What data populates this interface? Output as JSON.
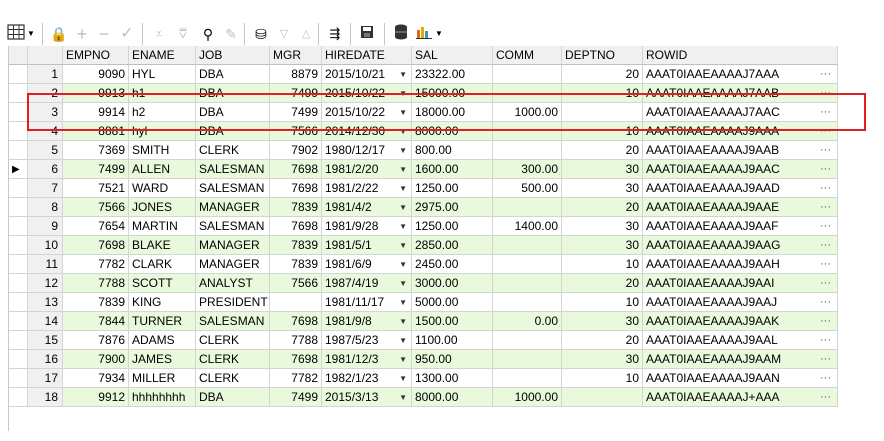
{
  "toolbar": {
    "icons": [
      "grid-icon",
      "dropdown-arrow-icon",
      "lock-icon",
      "add-icon",
      "remove-icon",
      "check-icon",
      "filter-icon",
      "filter-clear-icon",
      "binoculars-icon",
      "eraser-icon",
      "query-icon",
      "sort-down-icon",
      "sort-up-icon",
      "export-icon",
      "save-icon",
      "database-icon",
      "chart-icon"
    ]
  },
  "grid": {
    "columns": [
      "EMPNO",
      "ENAME",
      "JOB",
      "MGR",
      "HIREDATE",
      "SAL",
      "COMM",
      "DEPTNO",
      "ROWID"
    ],
    "rows": [
      {
        "n": "1",
        "empno": "9090",
        "ename": "HYL",
        "job": "DBA",
        "mgr": "8879",
        "hiredate": "2015/10/21",
        "sal": "23322.00",
        "comm": "",
        "deptno": "20",
        "rowid": "AAAT0IAAEAAAAJ7AAA"
      },
      {
        "n": "2",
        "empno": "9913",
        "ename": "h1",
        "job": "DBA",
        "mgr": "7499",
        "hiredate": "2015/10/22",
        "sal": "15000.00",
        "comm": "",
        "deptno": "10",
        "rowid": "AAAT0IAAEAAAAJ7AAB"
      },
      {
        "n": "3",
        "empno": "9914",
        "ename": "h2",
        "job": "DBA",
        "mgr": "7499",
        "hiredate": "2015/10/22",
        "sal": "18000.00",
        "comm": "1000.00",
        "deptno": "",
        "rowid": "AAAT0IAAEAAAAJ7AAC"
      },
      {
        "n": "4",
        "empno": "8881",
        "ename": "hyl",
        "job": "DBA",
        "mgr": "7566",
        "hiredate": "2014/12/30",
        "sal": "8000.00",
        "comm": "",
        "deptno": "10",
        "rowid": "AAAT0IAAEAAAAJ9AAA"
      },
      {
        "n": "5",
        "empno": "7369",
        "ename": "SMITH",
        "job": "CLERK",
        "mgr": "7902",
        "hiredate": "1980/12/17",
        "sal": "800.00",
        "comm": "",
        "deptno": "20",
        "rowid": "AAAT0IAAEAAAAJ9AAB"
      },
      {
        "n": "6",
        "empno": "7499",
        "ename": "ALLEN",
        "job": "SALESMAN",
        "mgr": "7698",
        "hiredate": "1981/2/20",
        "sal": "1600.00",
        "comm": "300.00",
        "deptno": "30",
        "rowid": "AAAT0IAAEAAAAJ9AAC"
      },
      {
        "n": "7",
        "empno": "7521",
        "ename": "WARD",
        "job": "SALESMAN",
        "mgr": "7698",
        "hiredate": "1981/2/22",
        "sal": "1250.00",
        "comm": "500.00",
        "deptno": "30",
        "rowid": "AAAT0IAAEAAAAJ9AAD"
      },
      {
        "n": "8",
        "empno": "7566",
        "ename": "JONES",
        "job": "MANAGER",
        "mgr": "7839",
        "hiredate": "1981/4/2",
        "sal": "2975.00",
        "comm": "",
        "deptno": "20",
        "rowid": "AAAT0IAAEAAAAJ9AAE"
      },
      {
        "n": "9",
        "empno": "7654",
        "ename": "MARTIN",
        "job": "SALESMAN",
        "mgr": "7698",
        "hiredate": "1981/9/28",
        "sal": "1250.00",
        "comm": "1400.00",
        "deptno": "30",
        "rowid": "AAAT0IAAEAAAAJ9AAF"
      },
      {
        "n": "10",
        "empno": "7698",
        "ename": "BLAKE",
        "job": "MANAGER",
        "mgr": "7839",
        "hiredate": "1981/5/1",
        "sal": "2850.00",
        "comm": "",
        "deptno": "30",
        "rowid": "AAAT0IAAEAAAAJ9AAG"
      },
      {
        "n": "11",
        "empno": "7782",
        "ename": "CLARK",
        "job": "MANAGER",
        "mgr": "7839",
        "hiredate": "1981/6/9",
        "sal": "2450.00",
        "comm": "",
        "deptno": "10",
        "rowid": "AAAT0IAAEAAAAJ9AAH"
      },
      {
        "n": "12",
        "empno": "7788",
        "ename": "SCOTT",
        "job": "ANALYST",
        "mgr": "7566",
        "hiredate": "1987/4/19",
        "sal": "3000.00",
        "comm": "",
        "deptno": "20",
        "rowid": "AAAT0IAAEAAAAJ9AAI"
      },
      {
        "n": "13",
        "empno": "7839",
        "ename": "KING",
        "job": "PRESIDENT",
        "mgr": "",
        "hiredate": "1981/11/17",
        "sal": "5000.00",
        "comm": "",
        "deptno": "10",
        "rowid": "AAAT0IAAEAAAAJ9AAJ"
      },
      {
        "n": "14",
        "empno": "7844",
        "ename": "TURNER",
        "job": "SALESMAN",
        "mgr": "7698",
        "hiredate": "1981/9/8",
        "sal": "1500.00",
        "comm": "0.00",
        "deptno": "30",
        "rowid": "AAAT0IAAEAAAAJ9AAK"
      },
      {
        "n": "15",
        "empno": "7876",
        "ename": "ADAMS",
        "job": "CLERK",
        "mgr": "7788",
        "hiredate": "1987/5/23",
        "sal": "1100.00",
        "comm": "",
        "deptno": "20",
        "rowid": "AAAT0IAAEAAAAJ9AAL"
      },
      {
        "n": "16",
        "empno": "7900",
        "ename": "JAMES",
        "job": "CLERK",
        "mgr": "7698",
        "hiredate": "1981/12/3",
        "sal": "950.00",
        "comm": "",
        "deptno": "30",
        "rowid": "AAAT0IAAEAAAAJ9AAM"
      },
      {
        "n": "17",
        "empno": "7934",
        "ename": "MILLER",
        "job": "CLERK",
        "mgr": "7782",
        "hiredate": "1982/1/23",
        "sal": "1300.00",
        "comm": "",
        "deptno": "10",
        "rowid": "AAAT0IAAEAAAAJ9AAN"
      },
      {
        "n": "18",
        "empno": "9912",
        "ename": "hhhhhhhh",
        "job": "DBA",
        "mgr": "7499",
        "hiredate": "2015/3/13",
        "sal": "8000.00",
        "comm": "1000.00",
        "deptno": "",
        "rowid": "AAAT0IAAEAAAAJ+AAA"
      }
    ],
    "current_row": "6"
  }
}
